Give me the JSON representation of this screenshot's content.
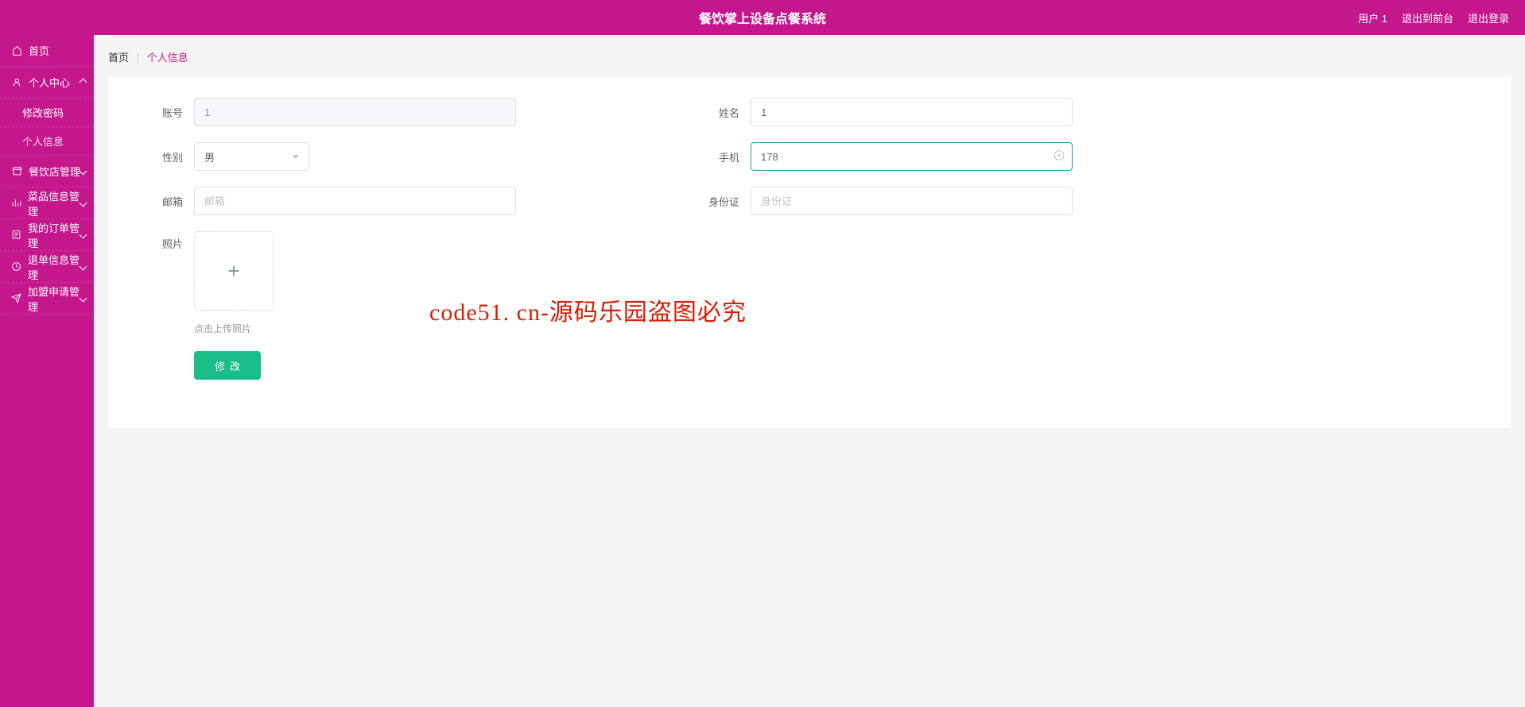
{
  "header": {
    "title": "餐饮掌上设备点餐系统",
    "user_label": "用户 1",
    "logout_front": "退出到前台",
    "logout": "退出登录"
  },
  "sidebar": {
    "home": "首页",
    "personal_center": "个人中心",
    "change_password": "修改密码",
    "personal_info": "个人信息",
    "restaurant_mgmt": "餐饮店管理",
    "dish_info_mgmt": "菜品信息管理",
    "my_order_mgmt": "我的订单管理",
    "refund_info_mgmt": "退单信息管理",
    "franchise_mgmt": "加盟申请管理"
  },
  "breadcrumb": {
    "home": "首页",
    "current": "个人信息"
  },
  "form": {
    "labels": {
      "account": "账号",
      "name": "姓名",
      "gender": "性别",
      "phone": "手机",
      "email": "邮箱",
      "idcard": "身份证",
      "photo": "照片"
    },
    "values": {
      "account": "1",
      "name": "1",
      "gender": "男",
      "phone": "178",
      "email": "",
      "idcard": ""
    },
    "placeholders": {
      "email": "邮箱",
      "idcard": "身份证"
    },
    "upload_hint": "点击上传照片",
    "submit": "修改"
  },
  "watermark": {
    "text": "code51.cn",
    "red_text": "code51. cn-源码乐园盗图必究"
  }
}
